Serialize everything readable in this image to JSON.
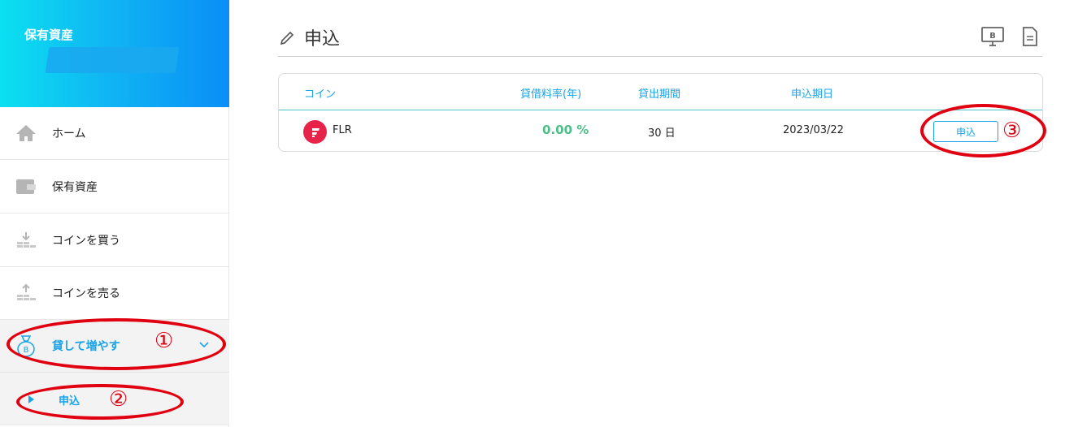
{
  "sidebar": {
    "header_title": "保有資産",
    "items": [
      {
        "label": "ホーム",
        "icon": "home-icon"
      },
      {
        "label": "保有資産",
        "icon": "wallet-icon"
      },
      {
        "label": "コインを買う",
        "icon": "coins-buy-icon"
      },
      {
        "label": "コインを売る",
        "icon": "coins-sell-icon"
      },
      {
        "label": "貸して増やす",
        "icon": "lending-bag-icon",
        "active": true
      }
    ],
    "sub_item": {
      "label": "申込"
    }
  },
  "page": {
    "title": "申込",
    "header_icons": [
      "bitcoin-monitor-icon",
      "document-icon"
    ]
  },
  "table": {
    "columns": [
      "コイン",
      "貸借料率(年)",
      "貸出期間",
      "申込期日"
    ],
    "rows": [
      {
        "coin": "FLR",
        "rate": "0.00 %",
        "period": "30 日",
        "deadline": "2023/03/22",
        "button": "申込"
      }
    ]
  },
  "annotations": [
    "①",
    "②",
    "③"
  ],
  "colors": {
    "accent": "#1aa3e8",
    "rate_green": "#4fbf8a",
    "annotation_red": "#e00010",
    "flr_logo": "#e8234a"
  }
}
